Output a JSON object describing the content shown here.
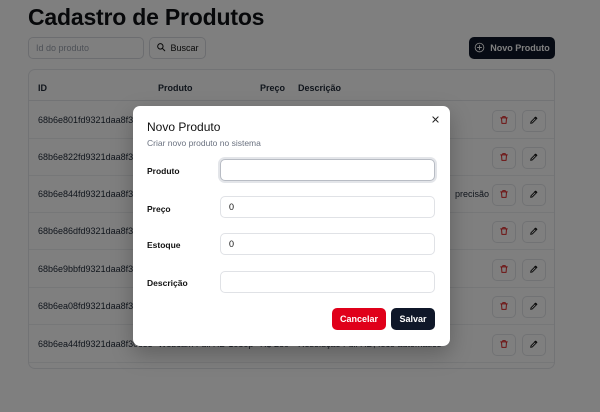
{
  "page": {
    "title": "Cadastro de Produtos",
    "search": {
      "placeholder": "Id do produto",
      "button_label": "Buscar"
    },
    "new_product_label": "Novo Produto"
  },
  "table": {
    "columns": [
      "ID",
      "Produto",
      "Preço",
      "Descrição"
    ],
    "rows": [
      {
        "id": "68b6e801fd9321daa8f30",
        "produto": "",
        "preco": "",
        "descricao": ""
      },
      {
        "id": "68b6e822fd9321daa8f30",
        "produto": "",
        "preco": "",
        "descricao": ""
      },
      {
        "id": "68b6e844fd9321daa8f30",
        "produto": "",
        "preco": "",
        "descricao": "precisão"
      },
      {
        "id": "68b6e86dfd9321daa8f30",
        "produto": "",
        "preco": "",
        "descricao": ""
      },
      {
        "id": "68b6e9bbfd9321daa8f30",
        "produto": "",
        "preco": "",
        "descricao": ""
      },
      {
        "id": "68b6ea08fd9321daa8f30",
        "produto": "",
        "preco": "",
        "descricao": ""
      },
      {
        "id": "68b6ea44fd9321daa8f30c85",
        "produto": "Webcam Full HD 1080p",
        "preco": "R$ 260",
        "descricao": "Resolução Full HD, foco automático"
      }
    ]
  },
  "modal": {
    "title": "Novo Produto",
    "subtitle": "Criar novo produto no sistema",
    "close_icon": "x-icon",
    "fields": {
      "produto": {
        "label": "Produto",
        "value": ""
      },
      "preco": {
        "label": "Preço",
        "value": "0"
      },
      "estoque": {
        "label": "Estoque",
        "value": "0"
      },
      "descricao": {
        "label": "Descrição",
        "value": ""
      }
    },
    "cancel_label": "Cancelar",
    "save_label": "Salvar"
  },
  "colors": {
    "primary": "#0f1729",
    "danger": "#e0001a",
    "trash_icon": "#dc2626"
  },
  "icons": {
    "search": "search-icon",
    "new": "plus-circle-icon",
    "delete": "trash-icon",
    "edit": "pencil-icon"
  }
}
